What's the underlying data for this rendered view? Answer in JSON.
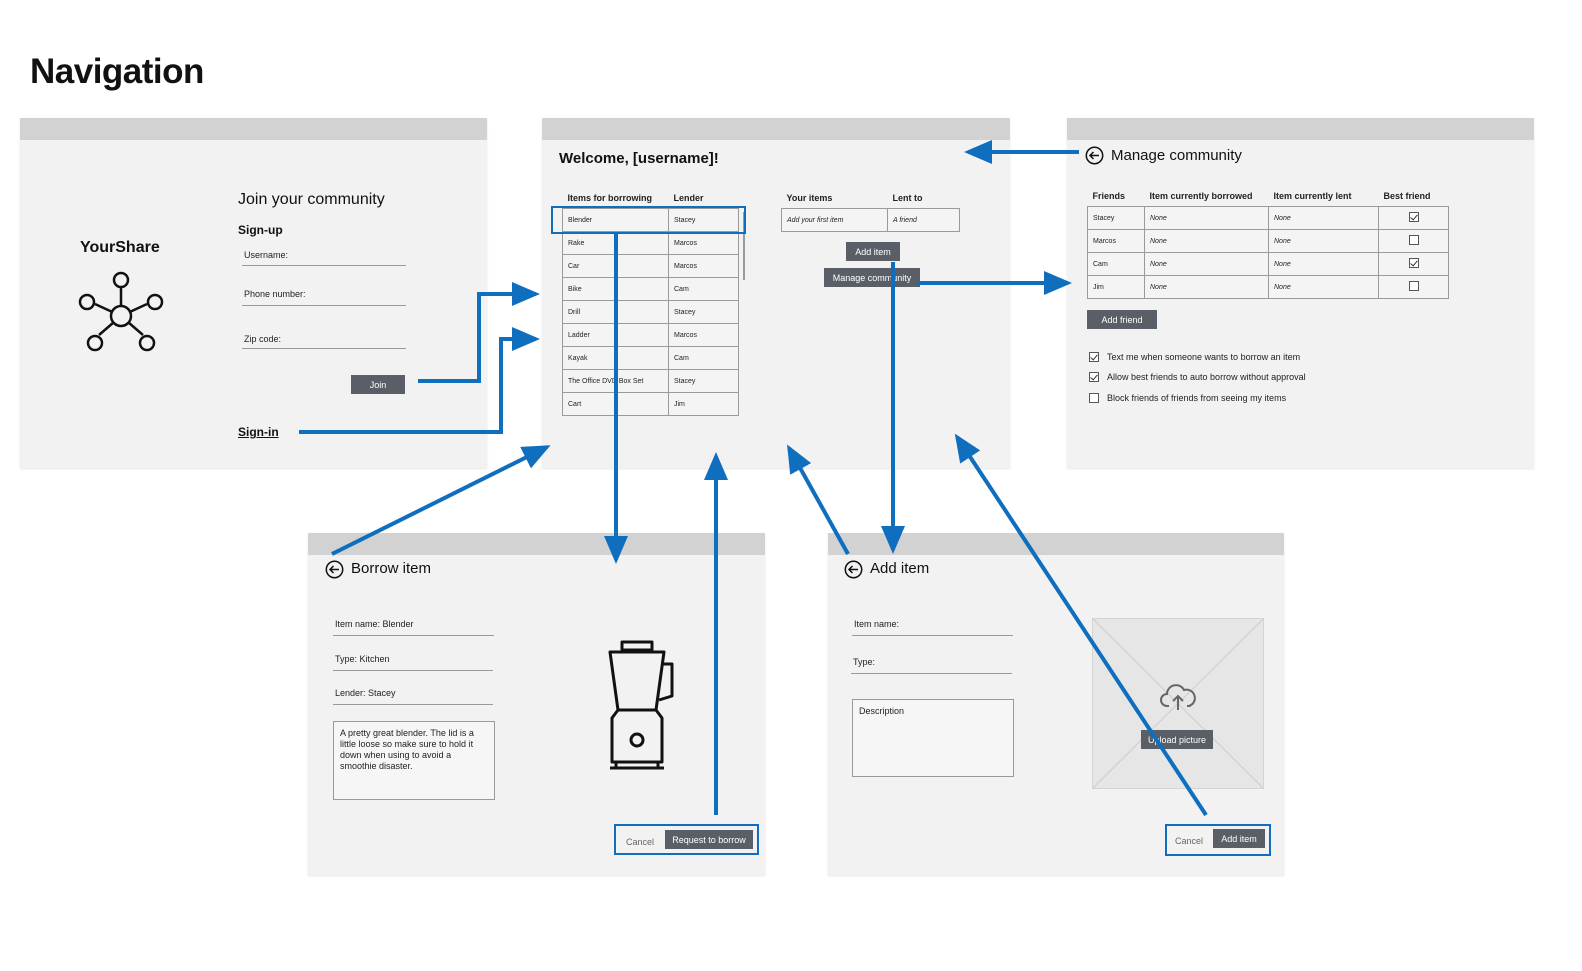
{
  "title": "Navigation",
  "signup_screen": {
    "logo_name": "YourShare",
    "heading": "Join your community",
    "section": "Sign-up",
    "username_label": "Username:",
    "phone_label": "Phone number:",
    "zip_label": "Zip code:",
    "join_label": "Join",
    "signin_label": "Sign-in"
  },
  "home_screen": {
    "welcome": "Welcome, [username]!",
    "borrow_table": {
      "headers": [
        "Items for borrowing",
        "Lender"
      ],
      "rows": [
        [
          "Blender",
          "Stacey"
        ],
        [
          "Rake",
          "Marcos"
        ],
        [
          "Car",
          "Marcos"
        ],
        [
          "Bike",
          "Cam"
        ],
        [
          "Drill",
          "Stacey"
        ],
        [
          "Ladder",
          "Marcos"
        ],
        [
          "Kayak",
          "Cam"
        ],
        [
          "The Office DVD Box Set",
          "Stacey"
        ],
        [
          "Cart",
          "Jim"
        ]
      ]
    },
    "your_table": {
      "headers": [
        "Your items",
        "Lent to"
      ],
      "rows": [
        [
          "Add your first item",
          "A friend"
        ]
      ]
    },
    "add_item_label": "Add item",
    "manage_label": "Manage community"
  },
  "community_screen": {
    "heading": "Manage community",
    "table": {
      "headers": [
        "Friends",
        "Item currently borrowed",
        "Item currently lent",
        "Best friend"
      ],
      "rows": [
        {
          "name": "Stacey",
          "borrowed": "None",
          "lent": "None",
          "best": true
        },
        {
          "name": "Marcos",
          "borrowed": "None",
          "lent": "None",
          "best": false
        },
        {
          "name": "Cam",
          "borrowed": "None",
          "lent": "None",
          "best": true
        },
        {
          "name": "Jim",
          "borrowed": "None",
          "lent": "None",
          "best": false
        }
      ]
    },
    "add_friend_label": "Add friend",
    "options": [
      {
        "label": "Text me when someone wants to borrow an item",
        "checked": true
      },
      {
        "label": "Allow best friends to auto borrow without approval",
        "checked": true
      },
      {
        "label": "Block friends of friends from seeing my items",
        "checked": false
      }
    ]
  },
  "borrow_screen": {
    "heading": "Borrow item",
    "item_name": "Item name: Blender",
    "type": "Type: Kitchen",
    "lender": "Lender: Stacey",
    "description": "A pretty great blender. The lid is a little loose so make sure to hold it down when using to avoid a smoothie disaster.",
    "cancel_label": "Cancel",
    "request_label": "Request to borrow"
  },
  "add_screen": {
    "heading": "Add item",
    "item_name_label": "Item name:",
    "type_label": "Type:",
    "description_label": "Description",
    "upload_label": "Upload picture",
    "cancel_label": "Cancel",
    "add_label": "Add item"
  },
  "colors": {
    "accent": "#106ebe",
    "screen_bg": "#f2f2f2",
    "title_bar": "#d2d2d2",
    "button": "#5a5f67"
  }
}
